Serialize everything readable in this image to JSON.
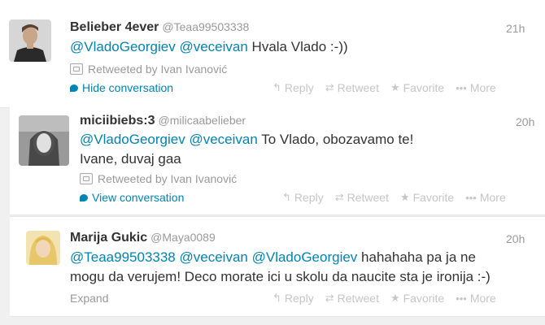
{
  "tweets": [
    {
      "name": "Belieber 4ever",
      "handle": "@Teaa99503338",
      "time": "21h",
      "mentions": [
        "@VladoGeorgiev",
        "@veceivan"
      ],
      "text": "Hvala Vlado :-))",
      "retweeted_by": "Retweeted by Ivan Ivanović",
      "conversation_link": "Hide conversation"
    },
    {
      "name": "miciibiebs:3",
      "handle": "@milicaabelieber",
      "time": "20h",
      "mentions": [
        "@VladoGeorgiev",
        "@veceivan"
      ],
      "text": "To Vlado, obozavamo te!",
      "text_line2": "Ivane, duvaj gaa",
      "retweeted_by": "Retweeted by Ivan Ivanović",
      "conversation_link": "View conversation"
    },
    {
      "name": "Marija Gukic",
      "handle": "@Maya0089",
      "time": "20h",
      "mentions": [
        "@Teaa99503338",
        "@veceivan",
        "@VladoGeorgiev"
      ],
      "text": "hahahaha pa ja ne",
      "text_line2": "mogu da verujem! Deco morate ici u skolu da naucite sta je ironija :-)",
      "expand_label": "Expand"
    }
  ],
  "actions": {
    "reply": "Reply",
    "retweet": "Retweet",
    "favorite": "Favorite",
    "more": "More"
  },
  "icons": {
    "reply": "reply-arrow-icon",
    "retweet": "retweet-icon",
    "favorite": "star-icon",
    "more": "more-dots-icon",
    "retweeted": "retweeted-icon",
    "conversation": "conversation-bubble-icon"
  },
  "colors": {
    "link": "#0084b4",
    "muted": "#999999",
    "text": "#333333",
    "action_inactive": "#c6c6c6"
  }
}
